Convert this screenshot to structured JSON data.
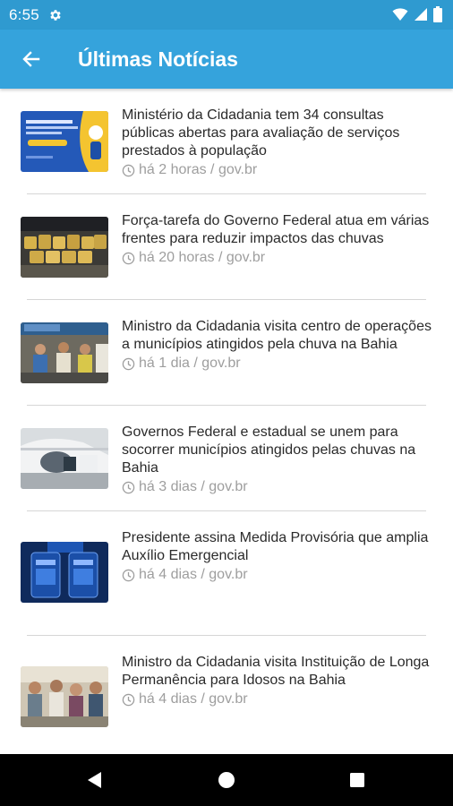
{
  "status_bar": {
    "time": "6:55",
    "icons": [
      "settings-icon",
      "wifi-icon",
      "signal-icon",
      "battery-icon"
    ]
  },
  "app_bar": {
    "title": "Últimas Notícias",
    "back_icon": "arrow-left-icon"
  },
  "news": [
    {
      "title": "Ministério da Cidadania tem 34 consultas públicas abertas para avaliação de serviços prestados à população",
      "meta": "há 2 horas / gov.br",
      "thumb": "consultas-publicas-banner"
    },
    {
      "title": "Força-tarefa do Governo Federal atua em várias frentes para reduzir impactos das chuvas",
      "meta": "há 20 horas / gov.br",
      "thumb": "supply-bags-photo"
    },
    {
      "title": "Ministro da Cidadania visita centro de operações a municípios atingidos pela chuva na Bahia",
      "meta": "há 1 dia / gov.br",
      "thumb": "meeting-room-photo"
    },
    {
      "title": "Governos Federal e estadual se unem para socorrer municípios atingidos pelas chuvas na Bahia",
      "meta": "há 3 dias / gov.br",
      "thumb": "helicopter-photo"
    },
    {
      "title": "Presidente assina Medida Provisória que amplia Auxílio Emergencial",
      "meta": "há 4 dias / gov.br",
      "thumb": "phone-app-banner"
    },
    {
      "title": "Ministro da Cidadania visita Instituição de Longa Permanência para Idosos na Bahia",
      "meta": "há 4 dias / gov.br",
      "thumb": "elderly-visit-photo"
    }
  ],
  "nav_bar": {
    "icons": [
      "back-triangle-icon",
      "home-circle-icon",
      "recents-square-icon"
    ]
  },
  "colors": {
    "status_bar": "#2f9ad0",
    "app_bar": "#35a3dc",
    "meta_text": "#9e9e9e"
  }
}
